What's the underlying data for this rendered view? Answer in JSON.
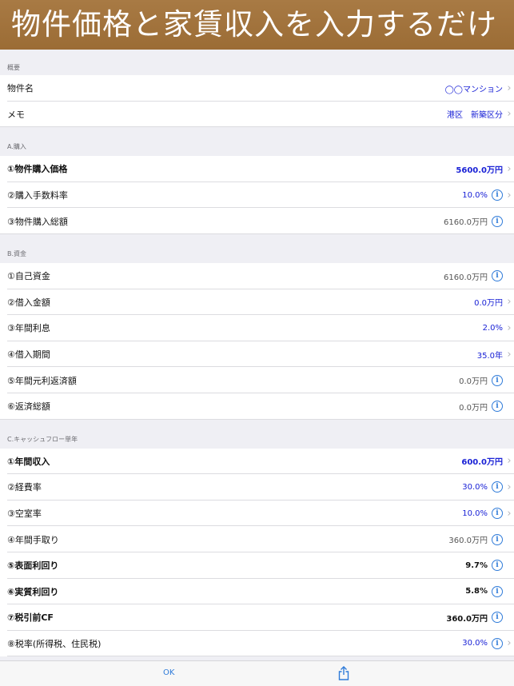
{
  "banner": {
    "text": "物件価格と家賃収入を入力するだけ"
  },
  "sections": {
    "overview": {
      "header": "概要",
      "rows": [
        {
          "label": "物件名",
          "value": "◯◯マンション"
        },
        {
          "label": "メモ",
          "value": "港区　新築区分"
        }
      ]
    },
    "purchase": {
      "header": "A.購入",
      "rows": [
        {
          "label": "①物件購入価格",
          "value": "5600.0万円"
        },
        {
          "label": "②購入手数料率",
          "value": "10.0%"
        },
        {
          "label": "③物件購入総額",
          "value": "6160.0万円"
        }
      ]
    },
    "funds": {
      "header": "B.資金",
      "rows": [
        {
          "label": "①自己資金",
          "value": "6160.0万円"
        },
        {
          "label": "②借入金額",
          "value": "0.0万円"
        },
        {
          "label": "③年間利息",
          "value": "2.0%"
        },
        {
          "label": "④借入期間",
          "value": "35.0年"
        },
        {
          "label": "⑤年間元利返済額",
          "value": "0.0万円"
        },
        {
          "label": "⑥返済総額",
          "value": "0.0万円"
        }
      ]
    },
    "cashflow": {
      "header": "C.キャッシュフロー単年",
      "rows": [
        {
          "label": "①年間収入",
          "value": "600.0万円"
        },
        {
          "label": "②経費率",
          "value": "30.0%"
        },
        {
          "label": "③空室率",
          "value": "10.0%"
        },
        {
          "label": "④年間手取り",
          "value": "360.0万円"
        },
        {
          "label": "⑤表面利回り",
          "value": "9.7%"
        },
        {
          "label": "⑥実質利回り",
          "value": "5.8%"
        },
        {
          "label": "⑦税引前CF",
          "value": "360.0万円"
        },
        {
          "label": "⑧税率(所得税、住民税)",
          "value": "30.0%"
        }
      ]
    }
  },
  "toolbar": {
    "ok_label": "OK",
    "share_icon": "share-icon"
  },
  "colors": {
    "accent_blue": "#1a22d6",
    "info_blue": "#2f7bd9",
    "banner_brown": "#a0713a"
  }
}
